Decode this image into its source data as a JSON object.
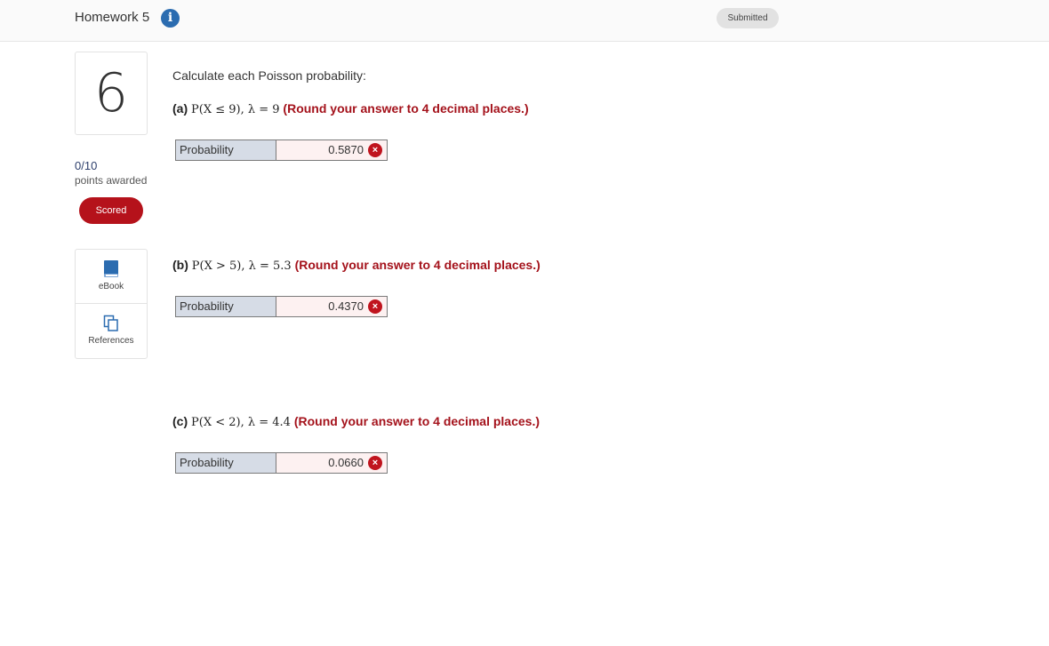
{
  "header": {
    "title": "Homework 5",
    "info_icon": "i",
    "status_badge": "Submitted"
  },
  "question": {
    "number": "6",
    "score": "0/10",
    "points_label": "points awarded",
    "scored_label": "Scored",
    "instruction": "Calculate each Poisson probability:"
  },
  "tools": {
    "ebook_label": "eBook",
    "references_label": "References"
  },
  "parts": [
    {
      "letter": "(a)",
      "expression": "P(X ≤ 9), λ = 9",
      "hint": "(Round your answer to 4 decimal places.)",
      "answer_label": "Probability",
      "answer_value": "0.5870",
      "status_icon": "×"
    },
    {
      "letter": "(b)",
      "expression": "P(X > 5), λ = 5.3",
      "hint": "(Round your answer to 4 decimal places.)",
      "answer_label": "Probability",
      "answer_value": "0.4370",
      "status_icon": "×"
    },
    {
      "letter": "(c)",
      "expression": "P(X < 2), λ = 4.4",
      "hint": "(Round your answer to 4 decimal places.)",
      "answer_label": "Probability",
      "answer_value": "0.0660",
      "status_icon": "×"
    }
  ],
  "colors": {
    "accent_red": "#b5121b",
    "info_blue": "#2b6cb0",
    "answer_label_bg": "#d6dce6"
  }
}
